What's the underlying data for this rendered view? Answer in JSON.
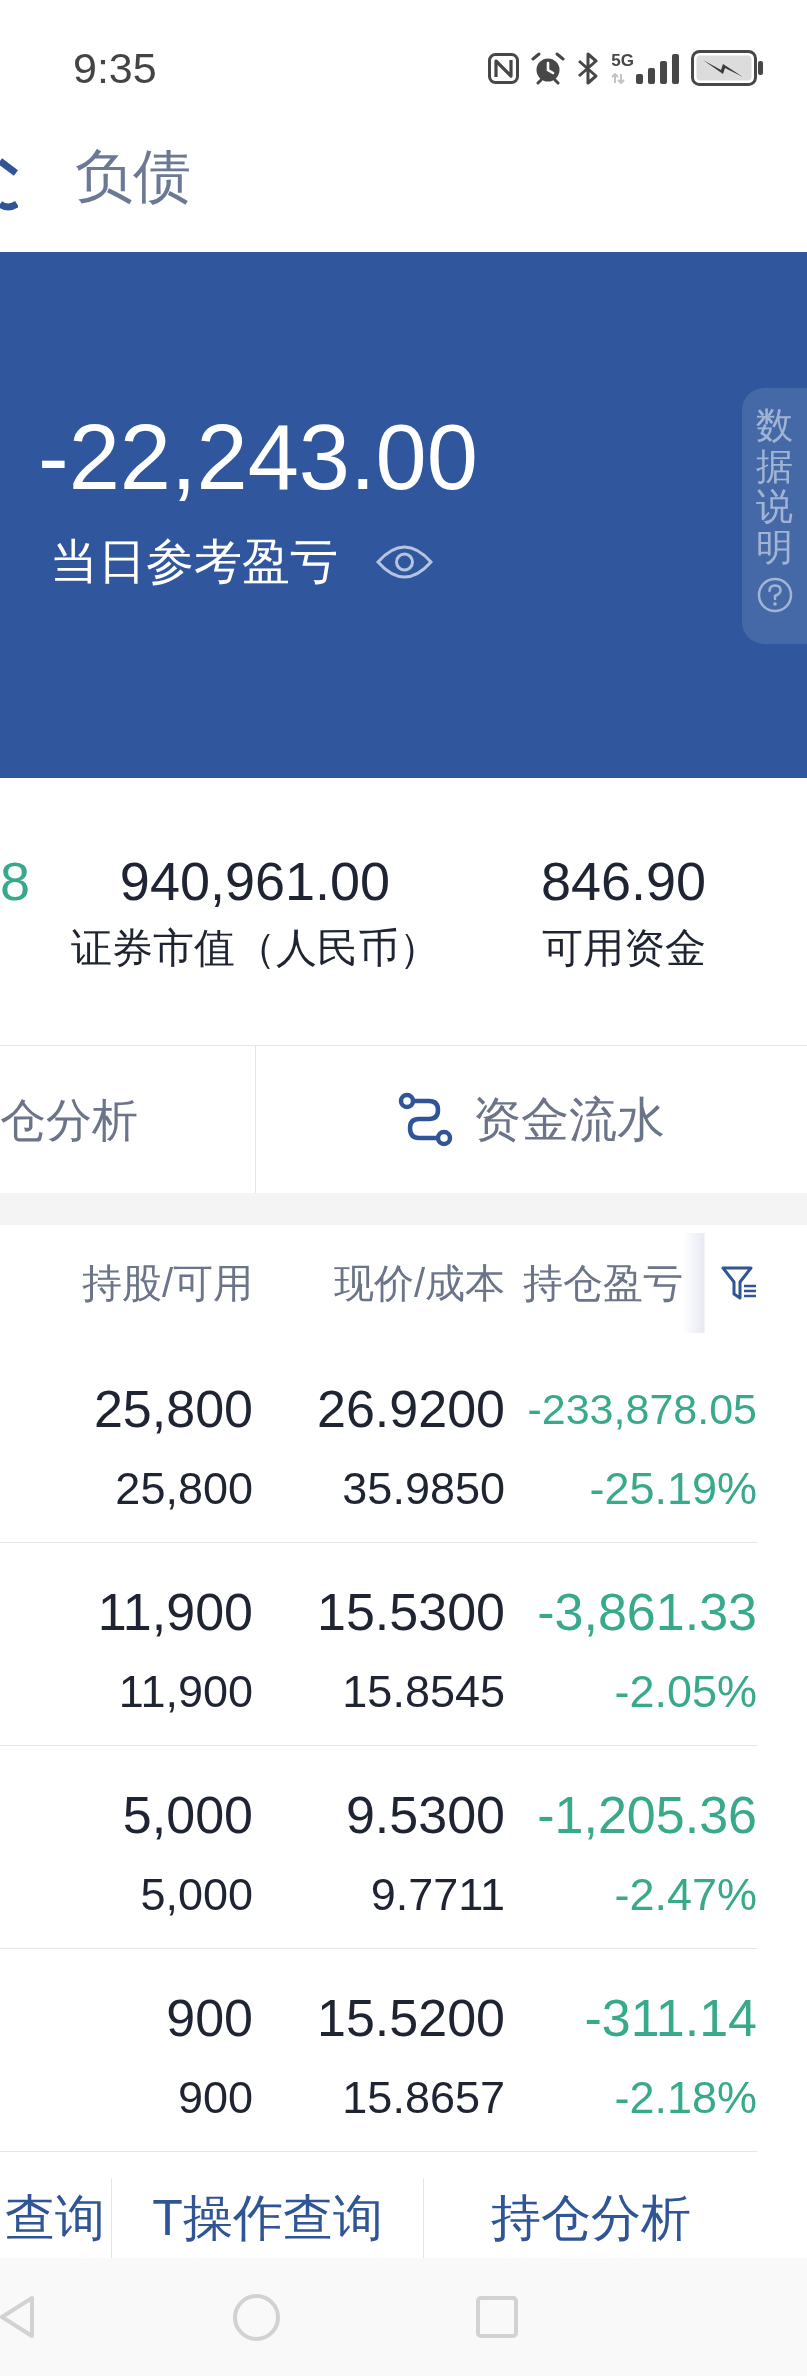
{
  "status_bar": {
    "time": "9:35",
    "network": "5G"
  },
  "header": {
    "tabs": [
      {
        "label": "负债",
        "selected": false
      }
    ]
  },
  "summary": {
    "value": "-22,243.00",
    "label": "当日参考盈亏",
    "side_tab": "数据说明"
  },
  "stats": [
    {
      "value": "8",
      "color": "#38a98b"
    },
    {
      "value": "940,961.00",
      "label": "证券市值（人民币）",
      "color": "#1f2433"
    },
    {
      "value": "846.90",
      "label": "可用资金",
      "color": "#1f2433"
    }
  ],
  "actions": [
    {
      "label": "仓分析",
      "kind": "plain"
    },
    {
      "label": "资金流水",
      "kind": "with_icon"
    }
  ],
  "table": {
    "columns": [
      "持股/可用",
      "现价/成本",
      "持仓盈亏"
    ],
    "rows": [
      {
        "shares": "25,800",
        "available": "25,800",
        "price": "26.9200",
        "cost": "35.9850",
        "pnl": "-233,878.05",
        "pnl_percent": "-25.19%",
        "color": "#38a98b"
      },
      {
        "shares": "11,900",
        "available": "11,900",
        "price": "15.5300",
        "cost": "15.8545",
        "pnl": "-3,861.33",
        "pnl_percent": "-2.05%",
        "color": "#38a98b"
      },
      {
        "shares": "5,000",
        "available": "5,000",
        "price": "9.5300",
        "cost": "9.7711",
        "pnl": "-1,205.36",
        "pnl_percent": "-2.47%",
        "color": "#38a98b"
      },
      {
        "shares": "900",
        "available": "900",
        "price": "15.5200",
        "cost": "15.8657",
        "pnl": "-311.14",
        "pnl_percent": "-2.18%",
        "color": "#38a98b"
      }
    ]
  },
  "bottom_links": [
    "查询",
    "T操作查询",
    "持仓分析"
  ]
}
